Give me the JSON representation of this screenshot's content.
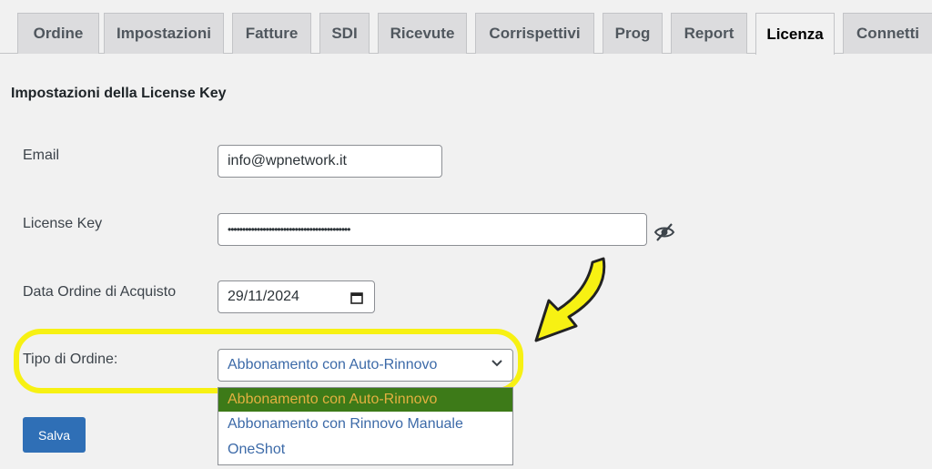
{
  "tabs": [
    "Ordine",
    "Impostazioni",
    "Fatture",
    "SDI",
    "Ricevute",
    "Corrispettivi",
    "Prog",
    "Report",
    "Licenza",
    "Connetti"
  ],
  "active_tab": "Licenza",
  "section_title": "Impostazioni della License Key",
  "form": {
    "email_label": "Email",
    "email_value": "info@wpnetwork.it",
    "license_label": "License Key",
    "license_value": "••••••••••••••••••••••••••••••••••••••••••",
    "date_label": "Data Ordine di Acquisto",
    "date_value": "29/11/2024",
    "order_type_label": "Tipo di Ordine:",
    "order_type_value": "Abbonamento con Auto-Rinnovo",
    "order_type_options": [
      "Abbonamento con Auto-Rinnovo",
      "Abbonamento con Rinnovo Manuale",
      "OneShot"
    ]
  },
  "save_label": "Salva",
  "colors": {
    "highlight": "#f7f113",
    "button": "#2f6fb6",
    "selected_option_bg": "#3d7a18"
  },
  "icons": {
    "eye": "eye-slash-icon",
    "calendar": "calendar-icon",
    "chevron": "chevron-down-icon",
    "arrow": "annotation-arrow"
  }
}
